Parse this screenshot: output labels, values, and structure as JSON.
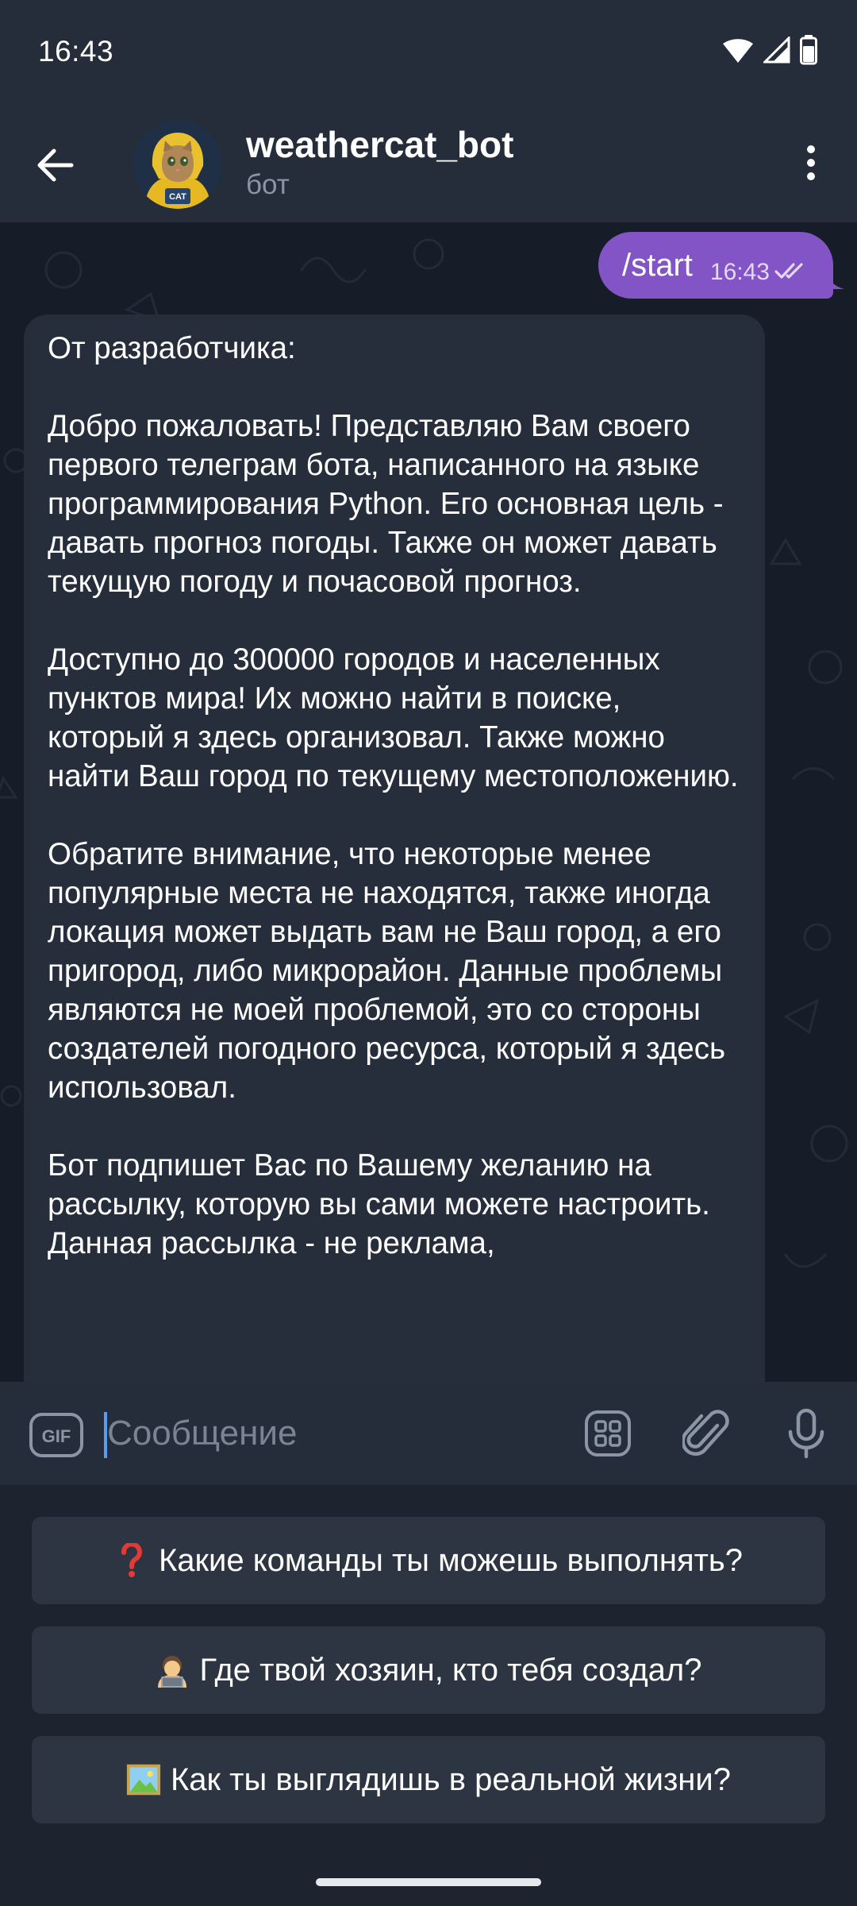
{
  "status_bar": {
    "time": "16:43"
  },
  "header": {
    "title": "weathercat_bot",
    "subtitle": "бот",
    "avatar_badge": "CAT",
    "back_icon": "arrow-left-icon",
    "menu_icon": "more-vertical-icon"
  },
  "messages": {
    "outgoing": {
      "text": "/start",
      "time": "16:43",
      "status_icon": "double-check-icon"
    },
    "incoming": {
      "paragraphs": [
        "От разработчика:",
        "Добро пожаловать! Представляю Вам своего первого телеграм бота, написанного на языке программирования Python. Его основная цель - давать прогноз погоды. Также он может давать текущую погоду и почасовой прогноз.",
        "Доступно до 300000 городов и населенных пунктов мира! Их можно найти в поиске, который я здесь организовал. Также можно найти Ваш город по текущему местоположению.",
        "Обратите внимание, что некоторые менее популярные места не находятся, также иногда локация может выдать вам не Ваш город, а его пригород, либо микрорайон. Данные проблемы являются не моей проблемой, это со стороны создателей погодного ресурса, который я здесь использовал.",
        "Бот подпишет Вас по Вашему желанию на рассылку, которую вы сами можете настроить. Данная рассылка - не реклама,"
      ]
    }
  },
  "input": {
    "placeholder": "Сообщение",
    "gif_label": "GIF",
    "keyboard_icon": "bot-keyboard-icon",
    "attach_icon": "paperclip-icon",
    "mic_icon": "microphone-icon"
  },
  "keyboard": {
    "buttons": [
      {
        "emoji": "red-question-mark-icon",
        "label": "Какие команды ты можешь выполнять?"
      },
      {
        "emoji": "man-technologist-icon",
        "label": "Где твой хозяин, кто тебя создал?"
      },
      {
        "emoji": "framed-picture-icon",
        "label": "Как ты выглядишь в реальной жизни?"
      }
    ]
  },
  "colors": {
    "accent_outgoing": "#8254c6",
    "incoming_bubble": "#262d3b",
    "chat_background": "#161d28",
    "bars": "#252d3a",
    "caret": "#5b9cf0"
  }
}
